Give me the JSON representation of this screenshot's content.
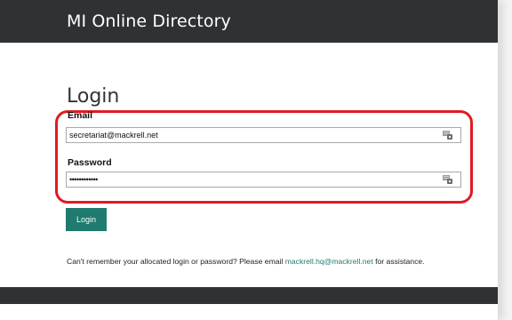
{
  "header": {
    "title": "MI Online Directory"
  },
  "form": {
    "heading": "Login",
    "email_label": "Email",
    "email_value": "secretariat@mackrell.net",
    "password_label": "Password",
    "password_value": "••••••••••••",
    "submit_label": "Login"
  },
  "help": {
    "prefix": "Can't remember your allocated login or password? Please email",
    "email_link": "mackrell.hq@mackrell.net",
    "suffix": "for assistance."
  },
  "colors": {
    "header_bg": "#2f3132",
    "accent": "#1f7b6f",
    "highlight": "#e01b22"
  },
  "icons": [
    "password-manager-key-icon"
  ]
}
